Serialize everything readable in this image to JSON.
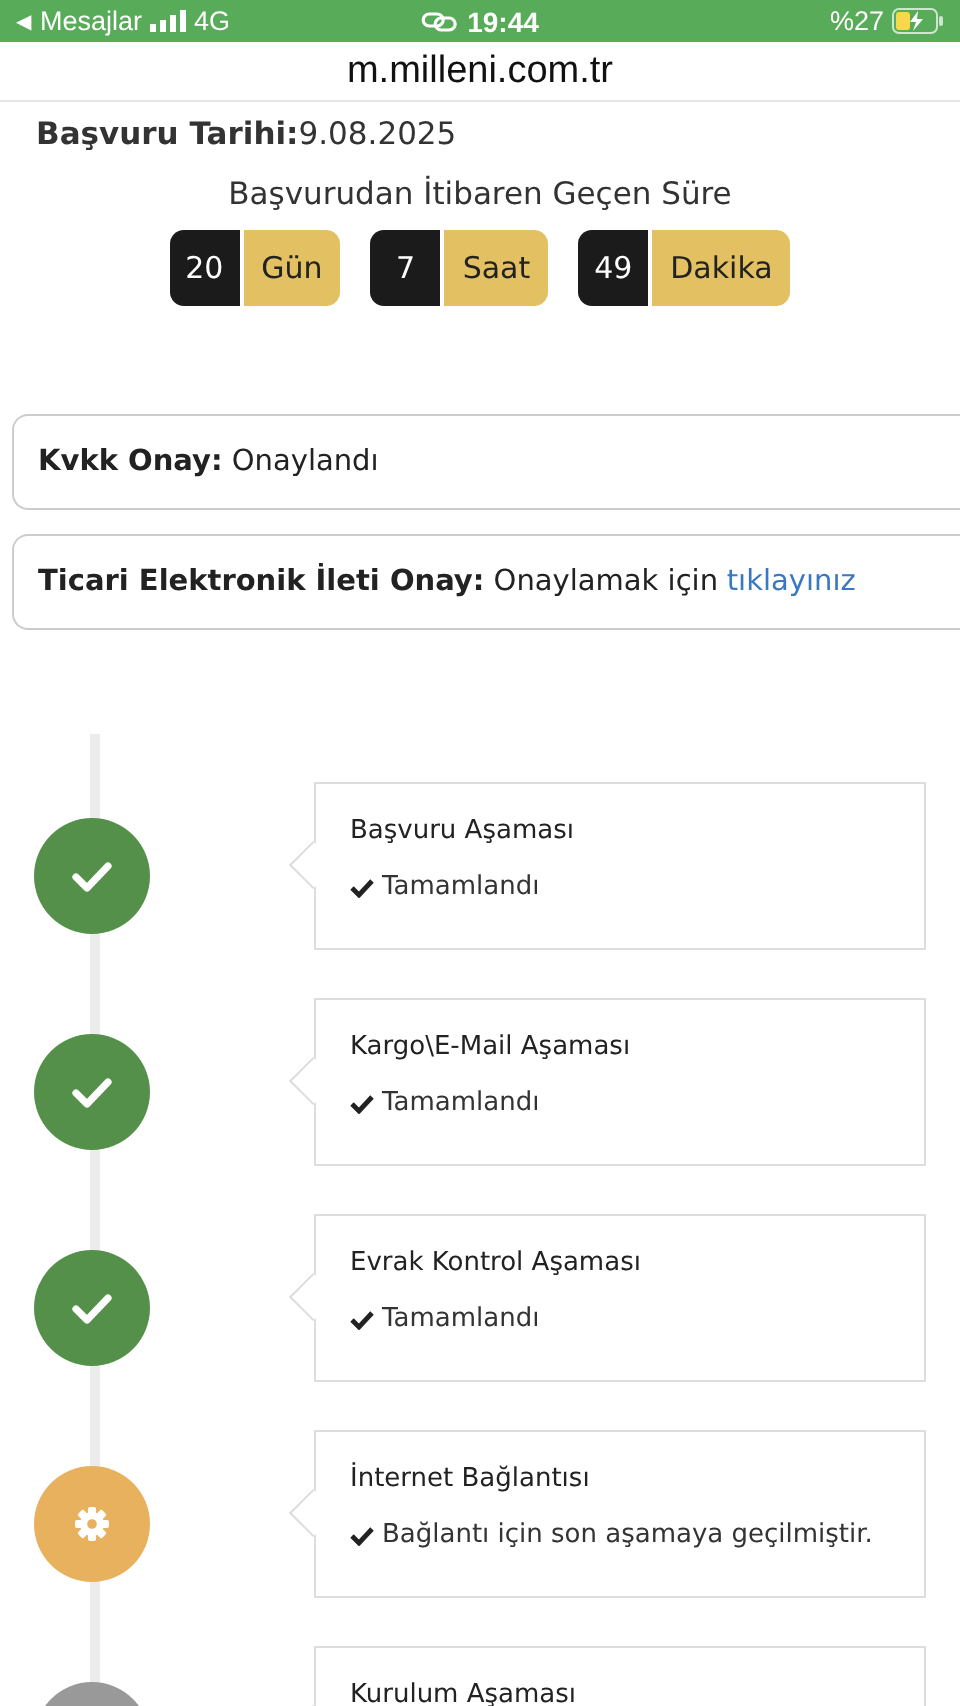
{
  "status_bar": {
    "back": "◀",
    "app": "Mesajlar",
    "network": "4G",
    "time": "19:44",
    "battery": "%27"
  },
  "url": "m.milleni.com.tr",
  "application_date": {
    "label": "Başvuru Tarihi:",
    "value": "9.08.2025"
  },
  "elapsed": {
    "title": "Başvurudan İtibaren Geçen Süre",
    "units": [
      {
        "value": "20",
        "unit": "Gün"
      },
      {
        "value": "7",
        "unit": "Saat"
      },
      {
        "value": "49",
        "unit": "Dakika"
      }
    ]
  },
  "consents": [
    {
      "label": "Kvkk Onay:",
      "text": "Onaylandı"
    },
    {
      "label": "Ticari Elektronik İleti Onay:",
      "text": "Onaylamak için",
      "link": "tıklayınız"
    }
  ],
  "steps": [
    {
      "kind": "done",
      "title": "Başvuru Aşaması",
      "status": "Tamamlandı"
    },
    {
      "kind": "done",
      "title": "Kargo\\E-Mail Aşaması",
      "status": "Tamamlandı"
    },
    {
      "kind": "done",
      "title": "Evrak Kontrol Aşaması",
      "status": "Tamamlandı"
    },
    {
      "kind": "active",
      "title": "İnternet Bağlantısı",
      "status": "Bağlantı için son aşamaya geçilmiştir."
    },
    {
      "kind": "pending",
      "title": "Kurulum Aşaması"
    }
  ]
}
